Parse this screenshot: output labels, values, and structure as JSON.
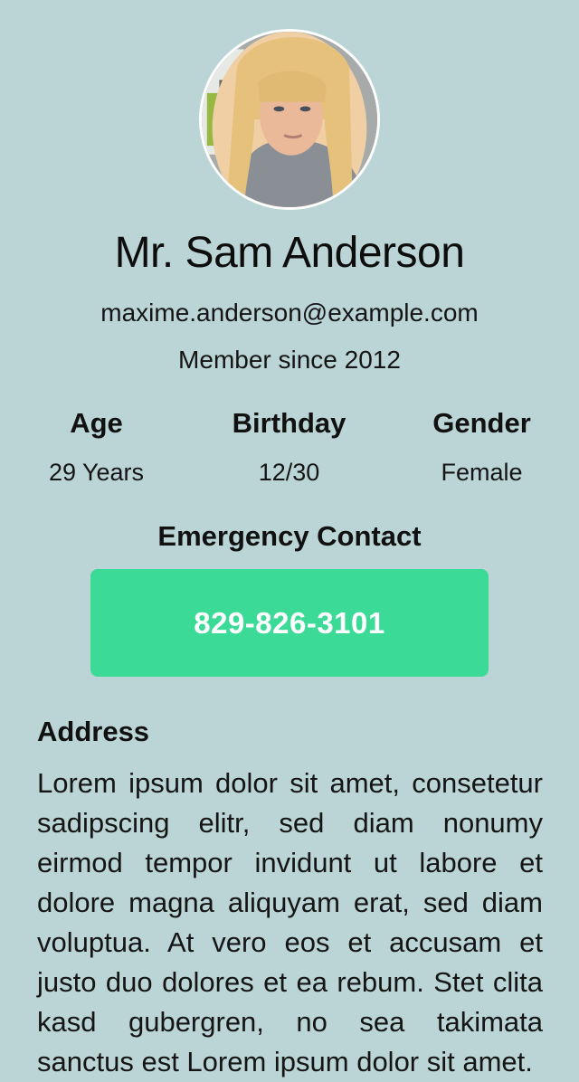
{
  "profile": {
    "avatar_icon": "profile-photo",
    "name": "Mr. Sam Anderson",
    "email": "maxime.anderson@example.com",
    "member_since": "Member since 2012"
  },
  "stats": {
    "age": {
      "label": "Age",
      "value": "29 Years"
    },
    "birthday": {
      "label": "Birthday",
      "value": "12/30"
    },
    "gender": {
      "label": "Gender",
      "value": "Female"
    }
  },
  "emergency": {
    "title": "Emergency Contact",
    "phone": "829-826-3101"
  },
  "address": {
    "title": "Address",
    "text": "Lorem ipsum dolor sit amet, consetetur sadipscing elitr, sed diam nonumy eirmod tempor invidunt ut labore et dolore magna aliquyam erat, sed diam voluptua. At vero eos et accusam et justo duo dolores et ea rebum. Stet clita kasd gubergren, no sea takimata sanctus est Lorem ipsum dolor sit amet."
  },
  "colors": {
    "background": "#bbd5d6",
    "button": "#3bdb97",
    "button_text": "#ffffff"
  }
}
